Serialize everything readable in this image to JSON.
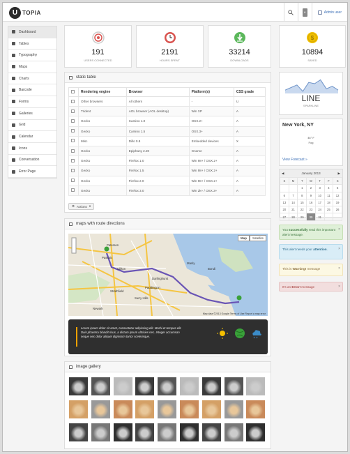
{
  "brand": {
    "letter": "U",
    "name": "TOPIA"
  },
  "topbar": {
    "admin_label": "Admin user",
    "notif_count": "8"
  },
  "sidebar": {
    "items": [
      {
        "label": "Dashboard",
        "icon": "dashboard-icon"
      },
      {
        "label": "Tables",
        "icon": "table-icon"
      },
      {
        "label": "Typography",
        "icon": "typography-icon"
      },
      {
        "label": "Maps",
        "icon": "map-icon"
      },
      {
        "label": "Charts",
        "icon": "chart-icon"
      },
      {
        "label": "Barcode",
        "icon": "barcode-icon"
      },
      {
        "label": "Forms",
        "icon": "pencil-icon"
      },
      {
        "label": "Galleries",
        "icon": "gallery-icon"
      },
      {
        "label": "Grid",
        "icon": "grid-icon"
      },
      {
        "label": "Calendar",
        "icon": "calendar-icon"
      },
      {
        "label": "Icons",
        "icon": "tag-icon"
      },
      {
        "label": "Conversation",
        "icon": "chat-icon"
      },
      {
        "label": "Error Page",
        "icon": "error-icon"
      }
    ]
  },
  "stats": [
    {
      "value": "191",
      "label": "USERS CONNECTED",
      "icon": "signal-icon",
      "color": "#d9534f"
    },
    {
      "value": "2191",
      "label": "HOURS SPENT",
      "icon": "clock-icon",
      "color": "#d9534f"
    },
    {
      "value": "33214",
      "label": "Downloads",
      "icon": "download-icon",
      "color": "#5cb85c"
    },
    {
      "value": "10894",
      "label": "SAVED",
      "icon": "coin-icon",
      "color": "#f0c000"
    }
  ],
  "static_table": {
    "title": "static table",
    "headers": [
      "Rendering engine",
      "Browser",
      "Platform(s)",
      "CSS grade"
    ],
    "rows": [
      [
        "Other browsers",
        "All others",
        "-",
        "U"
      ],
      [
        "Trident",
        "AOL browser (AOL desktop)",
        "Win XP",
        "A"
      ],
      [
        "Gecko",
        "Camino 1.0",
        "OSX.2+",
        "A"
      ],
      [
        "Gecko",
        "Camino 1.5",
        "OSX.3+",
        "A"
      ],
      [
        "Misc",
        "Dillo 0.8",
        "Embedded devices",
        "X"
      ],
      [
        "Gecko",
        "Epiphany 2.20",
        "Gnome",
        "A"
      ],
      [
        "Gecko",
        "Firefox 1.0",
        "Win 98+ / OSX.2+",
        "A"
      ],
      [
        "Gecko",
        "Firefox 1.5",
        "Win 98+ / OSX.2+",
        "A"
      ],
      [
        "Gecko",
        "Firefox 2.0",
        "Win 98+ / OSX.2+",
        "A"
      ],
      [
        "Gecko",
        "Firefox 3.0",
        "Win 2k+ / OSX.3+",
        "A"
      ]
    ],
    "actions_label": "Actions"
  },
  "map_panel": {
    "title": "maps with route directions",
    "map_btn": "Map",
    "sat_btn": "Satellite",
    "places": [
      "Passaic",
      "Paterson",
      "Clifton",
      "Darlinghurst",
      "Paddington",
      "Surry Hills",
      "Manly",
      "Strathfield",
      "Bondi",
      "Newark"
    ],
    "footer": "Map data ©2013 Google   Terms of Use   Report a map error",
    "weather_text": "Lorem ipsum dolor sit amet, consectetur adipiscing elit. Morbi et tempus elit. Duis pharetra blandit risus, a dictum ipsum ultricies nec. Integer accumsan neque nec dolor aliquet dignissim tortor scelerisque."
  },
  "gallery": {
    "title": "image gallery"
  },
  "line": {
    "title": "LINE",
    "sub": "SPARKLINE",
    "points": [
      22,
      18,
      14,
      24,
      10,
      12,
      6,
      20,
      16,
      22
    ]
  },
  "weather": {
    "city": "New York, NY",
    "temp": "46° F",
    "condition": "Fog",
    "link": "View Forecast »"
  },
  "calendar": {
    "month": "January 2013",
    "days": [
      "S",
      "M",
      "T",
      "W",
      "T",
      "F",
      "S"
    ],
    "weeks": [
      [
        "",
        "",
        "1",
        "2",
        "3",
        "4",
        "5"
      ],
      [
        "6",
        "7",
        "8",
        "9",
        "10",
        "11",
        "12"
      ],
      [
        "13",
        "14",
        "15",
        "16",
        "17",
        "18",
        "19"
      ],
      [
        "20",
        "21",
        "22",
        "23",
        "24",
        "25",
        "26"
      ],
      [
        "27",
        "28",
        "29",
        "30",
        "31",
        "",
        ""
      ]
    ],
    "today": "30"
  },
  "alerts": [
    {
      "pre": "You ",
      "bold": "successfully",
      "post": " read this important alert message.",
      "bg": "#dff0d8",
      "border": "#c6dfb5",
      "color": "#3c763d"
    },
    {
      "pre": "This alert needs your ",
      "bold": "attention",
      "post": ".",
      "bg": "#d9edf7",
      "border": "#b9dced",
      "color": "#31708f"
    },
    {
      "pre": "This is ",
      "bold": "Warning!",
      "post": " message",
      "bg": "#fcf8e3",
      "border": "#f1e3b9",
      "color": "#8a6d3b"
    },
    {
      "pre": "It's an ",
      "bold": "Error!",
      "post": " message",
      "bg": "#f2dede",
      "border": "#e6c4c4",
      "color": "#a94442"
    }
  ]
}
